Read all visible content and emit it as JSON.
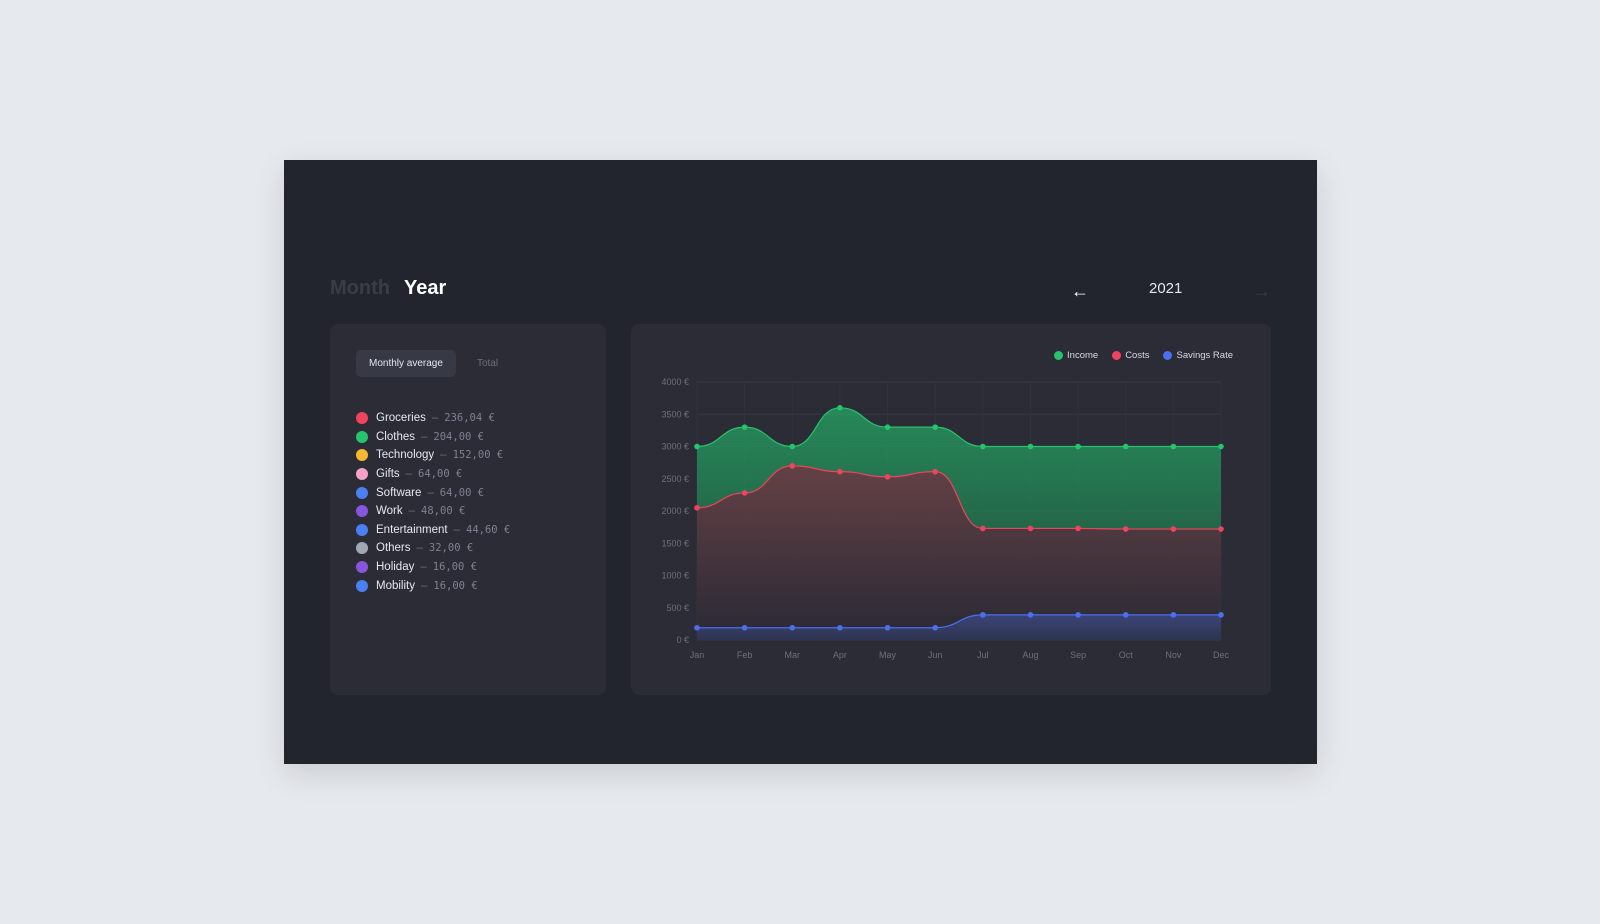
{
  "header": {
    "period_options": [
      "Month",
      "Year"
    ],
    "active_period": "Year",
    "year": "2021",
    "prev_arrow": "←",
    "next_arrow": "→"
  },
  "left_panel": {
    "tabs": [
      {
        "label": "Monthly average",
        "active": true
      },
      {
        "label": "Total",
        "active": false
      }
    ],
    "separator": "–",
    "categories": [
      {
        "name": "Groceries",
        "amount": "236,04 €",
        "color": "#f0435d"
      },
      {
        "name": "Clothes",
        "amount": "204,00 €",
        "color": "#27c46d"
      },
      {
        "name": "Technology",
        "amount": "152,00 €",
        "color": "#f6b733"
      },
      {
        "name": "Gifts",
        "amount": "64,00 €",
        "color": "#f6a2c8"
      },
      {
        "name": "Software",
        "amount": "64,00 €",
        "color": "#4c7ff3"
      },
      {
        "name": "Work",
        "amount": "48,00 €",
        "color": "#8a55de"
      },
      {
        "name": "Entertainment",
        "amount": "44,60 €",
        "color": "#4c7ff3"
      },
      {
        "name": "Others",
        "amount": "32,00 €",
        "color": "#a0a8b8"
      },
      {
        "name": "Holiday",
        "amount": "16,00 €",
        "color": "#8a55de"
      },
      {
        "name": "Mobility",
        "amount": "16,00 €",
        "color": "#4c7ff3"
      }
    ]
  },
  "chart_data": {
    "type": "area",
    "categories": [
      "Jan",
      "Feb",
      "Mar",
      "Apr",
      "May",
      "Jun",
      "Jul",
      "Aug",
      "Sep",
      "Oct",
      "Nov",
      "Dec"
    ],
    "series": [
      {
        "name": "Income",
        "color": "#27c46d",
        "values": [
          3000,
          3300,
          3000,
          3600,
          3300,
          3300,
          3000,
          3000,
          3000,
          3000,
          3000,
          3000
        ]
      },
      {
        "name": "Costs",
        "color": "#f0435d",
        "values": [
          2050,
          2280,
          2700,
          2610,
          2530,
          2610,
          1730,
          1730,
          1730,
          1720,
          1720,
          1720
        ]
      },
      {
        "name": "Savings Rate",
        "color": "#4c6ef0",
        "values": [
          190,
          190,
          190,
          190,
          190,
          190,
          390,
          390,
          390,
          390,
          390,
          390
        ]
      }
    ],
    "ylim": [
      0,
      4000
    ],
    "yticks": [
      "0 €",
      "500 €",
      "1000 €",
      "1500 €",
      "2000 €",
      "2500 €",
      "3000 €",
      "3500 €",
      "4000 €"
    ],
    "grid": true,
    "legend_position": "top-right"
  }
}
